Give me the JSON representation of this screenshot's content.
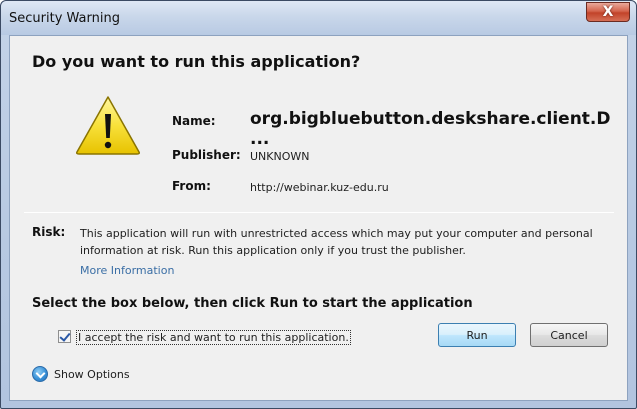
{
  "window": {
    "title": "Security Warning",
    "close_glyph": "X"
  },
  "dialog": {
    "heading": "Do you want to run this application?",
    "icon": "warning-triangle-icon",
    "info": {
      "name_label": "Name:",
      "name_value": "org.bigbluebutton.deskshare.client.D ...",
      "publisher_label": "Publisher:",
      "publisher_value": "UNKNOWN",
      "from_label": "From:",
      "from_value": "http://webinar.kuz-edu.ru"
    },
    "risk": {
      "label": "Risk:",
      "text": "This application will run with unrestricted access which may put your computer and personal information at risk. Run this application only if you trust the publisher.",
      "more_info_link": "More Information"
    },
    "select_heading": "Select the box below, then click Run to start the application",
    "checkbox": {
      "label": "I accept the risk and want to run this application.",
      "checked": true
    },
    "buttons": {
      "run": "Run",
      "cancel": "Cancel"
    },
    "show_options": "Show Options"
  },
  "colors": {
    "link": "#3a6ea5",
    "warning_yellow": "#f5d90a",
    "close_red": "#c2432a",
    "default_button_border": "#3c7fb1"
  }
}
